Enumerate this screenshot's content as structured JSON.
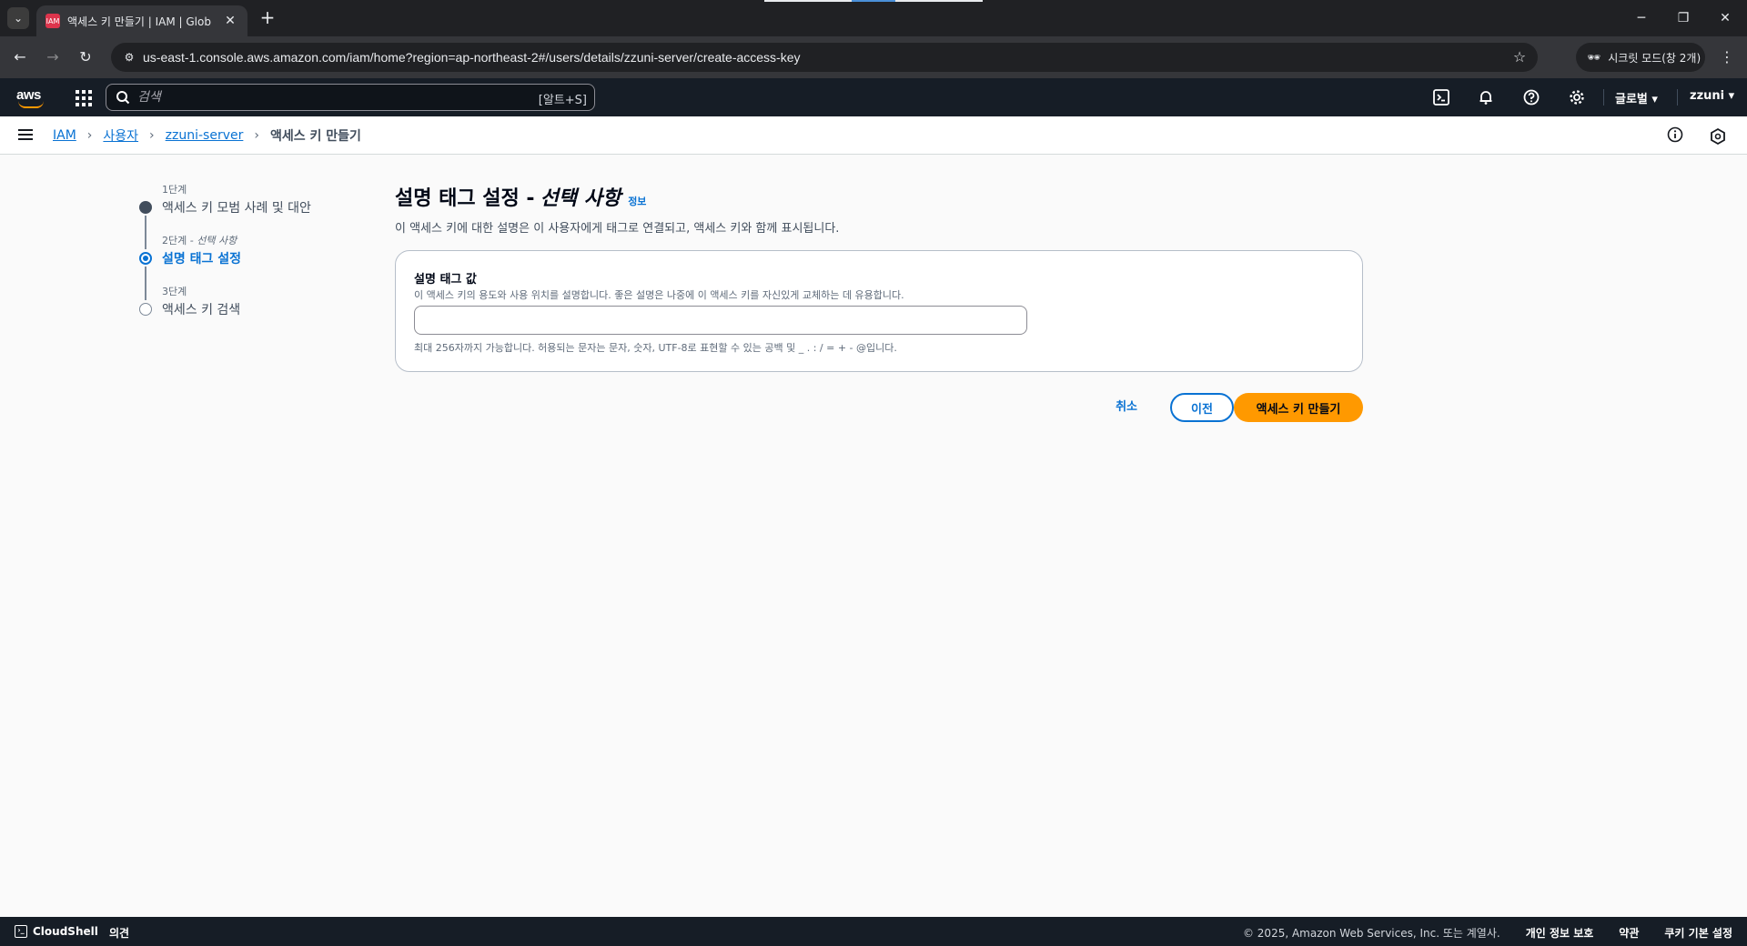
{
  "browser": {
    "tab_title": "액세스 키 만들기 | IAM | Glob",
    "url": "us-east-1.console.aws.amazon.com/iam/home?region=ap-northeast-2#/users/details/zzuni-server/create-access-key",
    "incognito_label": "시크릿 모드(창 2개)"
  },
  "aws_header": {
    "logo": "aws",
    "search_placeholder": "검색",
    "search_shortcut": "[알트+S]",
    "region_label": "글로벌",
    "user_label": "zzuni"
  },
  "breadcrumb": {
    "items": [
      "IAM",
      "사용자",
      "zzuni-server"
    ],
    "current": "액세스 키 만들기"
  },
  "steps": [
    {
      "step_label": "1단계",
      "step_label_optional": "",
      "title": "액세스 키 모범 사례 및 대안",
      "status": "done"
    },
    {
      "step_label": "2단계",
      "step_label_optional": " - 선택 사항",
      "title": "설명 태그 설정",
      "status": "active"
    },
    {
      "step_label": "3단계",
      "step_label_optional": "",
      "title": "액세스 키 검색",
      "status": "todo"
    }
  ],
  "main": {
    "title": "설명 태그 설정 -",
    "title_optional": "선택 사항",
    "info_link": "정보",
    "description": "이 액세스 키에 대한 설명은 이 사용자에게 태그로 연결되고, 액세스 키와 함께 표시됩니다.",
    "field_label": "설명 태그 값",
    "field_description": "이 액세스 키의 용도와 사용 위치를 설명합니다. 좋은 설명은 나중에 이 액세스 키를 자신있게 교체하는 데 유용합니다.",
    "field_value": "",
    "field_constraint": "최대 256자까지 가능합니다. 허용되는 문자는 문자, 숫자, UTF-8로 표현할 수 있는 공백 및 _ . : / = + - @입니다."
  },
  "actions": {
    "cancel": "취소",
    "previous": "이전",
    "create": "액세스 키 만들기"
  },
  "footer": {
    "cloudshell": "CloudShell",
    "feedback": "의견",
    "copyright": "© 2025, Amazon Web Services, Inc. 또는 계열사.",
    "privacy": "개인 정보 보호",
    "terms": "약관",
    "cookies": "쿠키 기본 설정"
  },
  "colors": {
    "accent": "#0972d3",
    "primary_button": "#ff9900",
    "header_bg": "#161d26"
  }
}
